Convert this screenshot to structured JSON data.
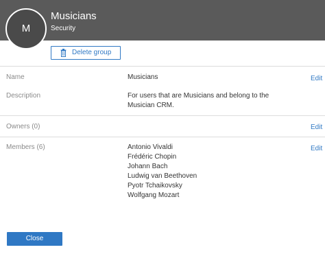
{
  "header": {
    "avatar_initial": "M",
    "title": "Musicians",
    "subtitle": "Security"
  },
  "actions": {
    "delete_label": "Delete group",
    "delete_icon": "trash-icon"
  },
  "fields": {
    "name": {
      "label": "Name",
      "value": "Musicians",
      "edit": "Edit"
    },
    "description": {
      "label": "Description",
      "value": "For users that are Musicians and belong to the Musician CRM."
    },
    "owners": {
      "label": "Owners (0)",
      "edit": "Edit"
    },
    "members": {
      "label": "Members (6)",
      "edit": "Edit",
      "list": [
        "Antonio Vivaldi",
        "Frédéric Chopin",
        "Johann Bach",
        "Ludwig van Beethoven",
        "Pyotr Tchaikovsky",
        "Wolfgang Mozart"
      ]
    }
  },
  "footer": {
    "close_label": "Close"
  },
  "colors": {
    "header_bg": "#5a5a5a",
    "accent": "#2f78c4"
  }
}
